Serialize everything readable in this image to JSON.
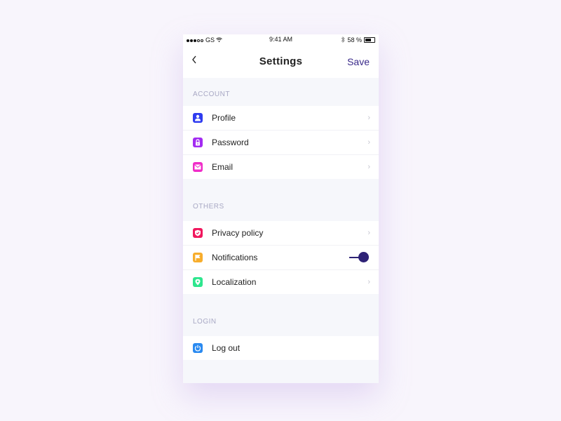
{
  "status_bar": {
    "carrier": "GS",
    "signal_filled": 3,
    "signal_empty": 2,
    "time": "9:41 AM",
    "battery_percent_label": "58 %",
    "battery_level": 0.58
  },
  "header": {
    "back_icon": "chevron-left",
    "title": "Settings",
    "save_label": "Save"
  },
  "sections": [
    {
      "label": "ACCOUNT",
      "items": [
        {
          "label": "Profile",
          "icon": "user-icon",
          "color": "#2f3cf0",
          "accessory": "chevron"
        },
        {
          "label": "Password",
          "icon": "lock-icon",
          "color": "#a32bf2",
          "accessory": "chevron"
        },
        {
          "label": "Email",
          "icon": "mail-icon",
          "color": "#f02cc8",
          "accessory": "chevron"
        }
      ]
    },
    {
      "label": "OTHERS",
      "items": [
        {
          "label": "Privacy policy",
          "icon": "shield-icon",
          "color": "#f0185e",
          "accessory": "chevron"
        },
        {
          "label": "Notifications",
          "icon": "flag-icon",
          "color": "#f7ad2c",
          "accessory": "toggle",
          "toggle_on": true
        },
        {
          "label": "Localization",
          "icon": "location-pin-icon",
          "color": "#2ee68e",
          "accessory": "chevron"
        }
      ]
    },
    {
      "label": "LOGIN",
      "items": [
        {
          "label": "Log out",
          "icon": "power-icon",
          "color": "#2a8af0",
          "accessory": "none"
        }
      ]
    }
  ],
  "accent_color": "#2e2276",
  "chevron_glyph": "›"
}
